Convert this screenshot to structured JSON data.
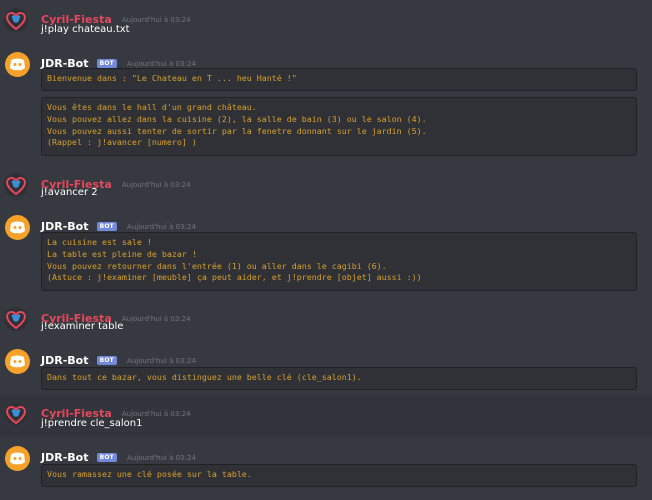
{
  "colors": {
    "background": "#36393f",
    "user_name": "#e8475b",
    "code_text": "#d7a02b",
    "bot_tag": "#7289da",
    "bot_avatar": "#f6a22a"
  },
  "messages": [
    {
      "author": "Cyril-Fiesta",
      "timestamp": "Aujourd'hui à 03:24",
      "text": "j!play chateau.txt"
    },
    {
      "author": "JDR-Bot",
      "bot_tag": "BOT",
      "timestamp": "Aujourd'hui à 03:24",
      "blocks": [
        "Bienvenue dans : \"Le Chateau en T ... heu Hanté !\"",
        "Vous êtes dans le hall d'un grand château.\nVous pouvez allez dans la cuisine (2), la salle de bain (3) ou le salon (4).\nVous pouvez aussi tenter de sortir par la fenetre donnant sur le jardin (5).\n(Rappel : j!avancer [numero] )"
      ]
    },
    {
      "author": "Cyril-Fiesta",
      "timestamp": "Aujourd'hui à 03:24",
      "text": "j!avancer 2"
    },
    {
      "author": "JDR-Bot",
      "bot_tag": "BOT",
      "timestamp": "Aujourd'hui à 03:24",
      "blocks": [
        "La cuisine est sale !\nLa table est pleine de bazar !\nVous pouvez retourner dans l'entrée (1) ou aller dans le cagibi (6).\n(Astuce : j!examiner [meuble] ça peut aider, et j!prendre [objet] aussi :))"
      ]
    },
    {
      "author": "Cyril-Fiesta",
      "timestamp": "Aujourd'hui à 03:24",
      "text": "j!examiner table"
    },
    {
      "author": "JDR-Bot",
      "bot_tag": "BOT",
      "timestamp": "Aujourd'hui à 03:24",
      "blocks": [
        "Dans tout ce bazar, vous distinguez une belle clé (cle_salon1)."
      ]
    },
    {
      "author": "Cyril-Fiesta",
      "timestamp": "Aujourd'hui à 03:24",
      "text": "j!prendre cle_salon1"
    },
    {
      "author": "JDR-Bot",
      "bot_tag": "BOT",
      "timestamp": "Aujourd'hui à 03:24",
      "blocks": [
        "Vous ramassez une clé posée sur la table."
      ]
    }
  ]
}
